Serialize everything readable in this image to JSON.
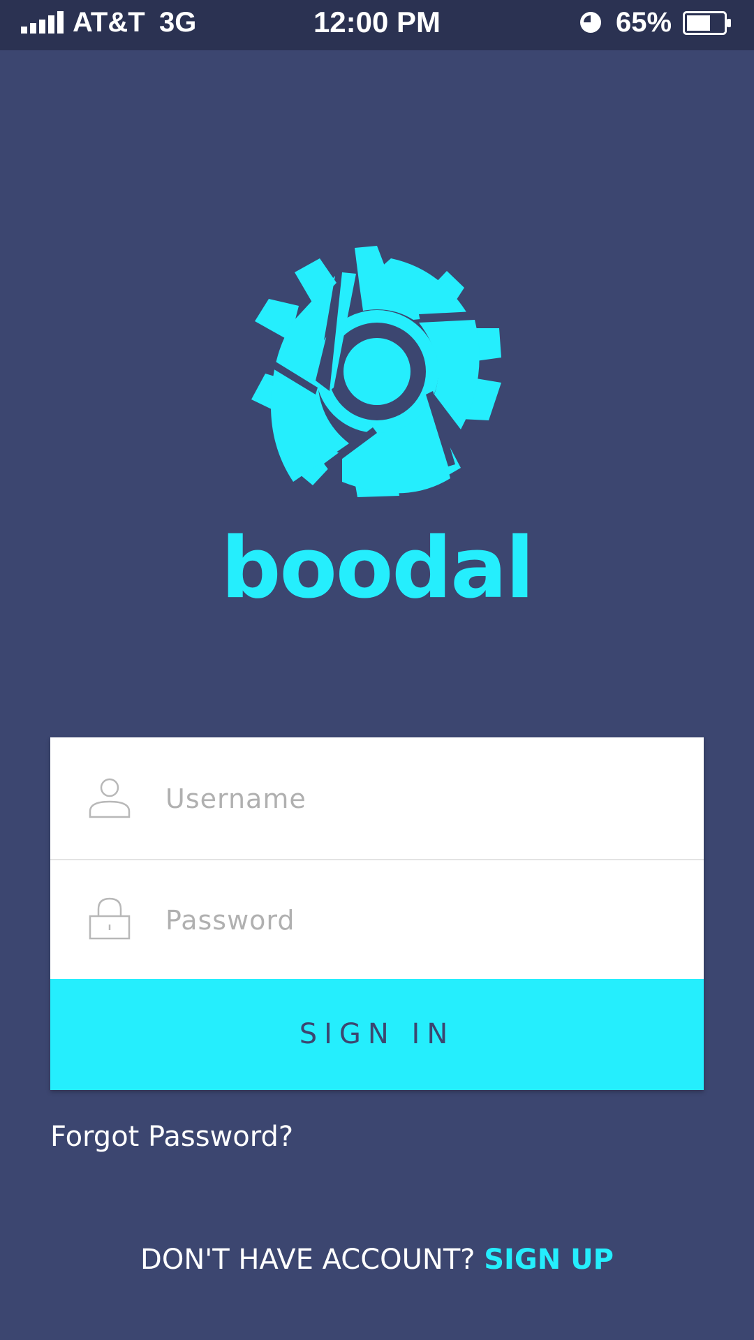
{
  "status_bar": {
    "carrier": "AT&T",
    "network": "3G",
    "time": "12:00 PM",
    "battery_percent": "65%",
    "battery_level": 0.65,
    "signal_icon": "signal-bars-icon",
    "alarm_icon": "alarm-clock-icon",
    "battery_icon": "battery-icon"
  },
  "brand": {
    "name": "boodal",
    "logo_icon": "gear-logo-icon",
    "color": "#25eefd"
  },
  "login_form": {
    "username": {
      "placeholder": "Username",
      "value": "",
      "icon": "user-icon"
    },
    "password": {
      "placeholder": "Password",
      "value": "",
      "icon": "lock-icon"
    },
    "sign_in_label": "SIGN IN"
  },
  "forgot_password_label": "Forgot Password?",
  "signup": {
    "prompt": "DON'T HAVE ACCOUNT?",
    "link_label": "SIGN UP"
  },
  "colors": {
    "background": "#3c4670",
    "status_bar": "#2b3252",
    "accent": "#25eefd",
    "card": "#ffffff"
  }
}
